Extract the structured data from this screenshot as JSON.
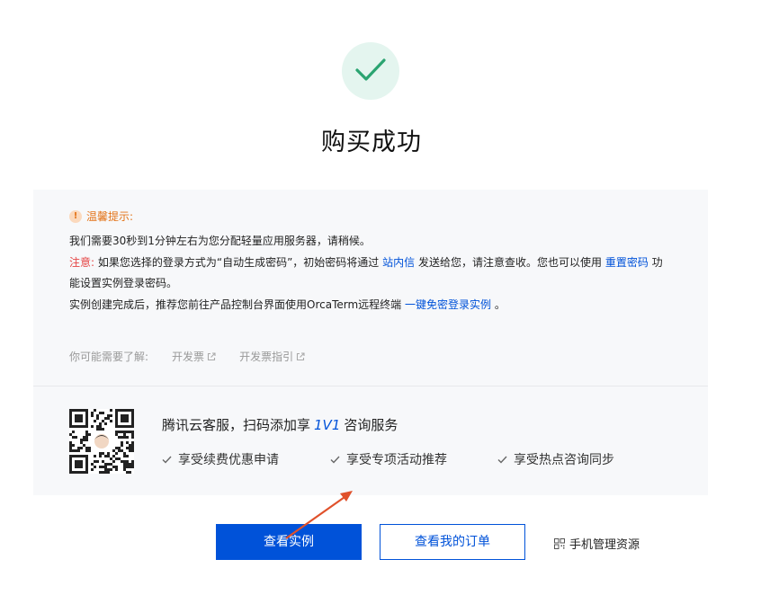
{
  "title": "购买成功",
  "tip": {
    "heading": "温馨提示:",
    "line1": "我们需要30秒到1分钟左右为您分配轻量应用服务器，请稍候。",
    "notice_label": "注意:",
    "notice_part1": "如果您选择的登录方式为“自动生成密码”，初始密码将通过",
    "notice_link1": "站内信",
    "notice_part2": "发送给您，请注意查收。您也可以使用",
    "notice_link2": "重置密码",
    "notice_part3": "功能设置实例登录密码。",
    "line3_text": "实例创建完成后，推荐您前往产品控制台界面使用OrcaTerm远程终端",
    "line3_link": "一键免密登录实例",
    "line3_end": "。"
  },
  "learn": {
    "label": "你可能需要了解:",
    "links": [
      "开发票",
      "开发票指引"
    ]
  },
  "service": {
    "title_prefix": "腾讯云客服，扫码添加享",
    "title_emphasis": "1V1",
    "title_suffix": "咨询服务",
    "benefits": [
      "享受续费优惠申请",
      "享受专项活动推荐",
      "享受热点咨询同步"
    ]
  },
  "actions": {
    "primary_label": "查看实例",
    "secondary_label": "查看我的订单",
    "mobile_label": "手机管理资源"
  },
  "colors": {
    "primary": "#0052d9",
    "success_bg": "#e4f5ef",
    "success_check": "#2ba471",
    "warning": "#e37318",
    "danger": "#e54545",
    "annotation_arrow": "#e0512b"
  }
}
